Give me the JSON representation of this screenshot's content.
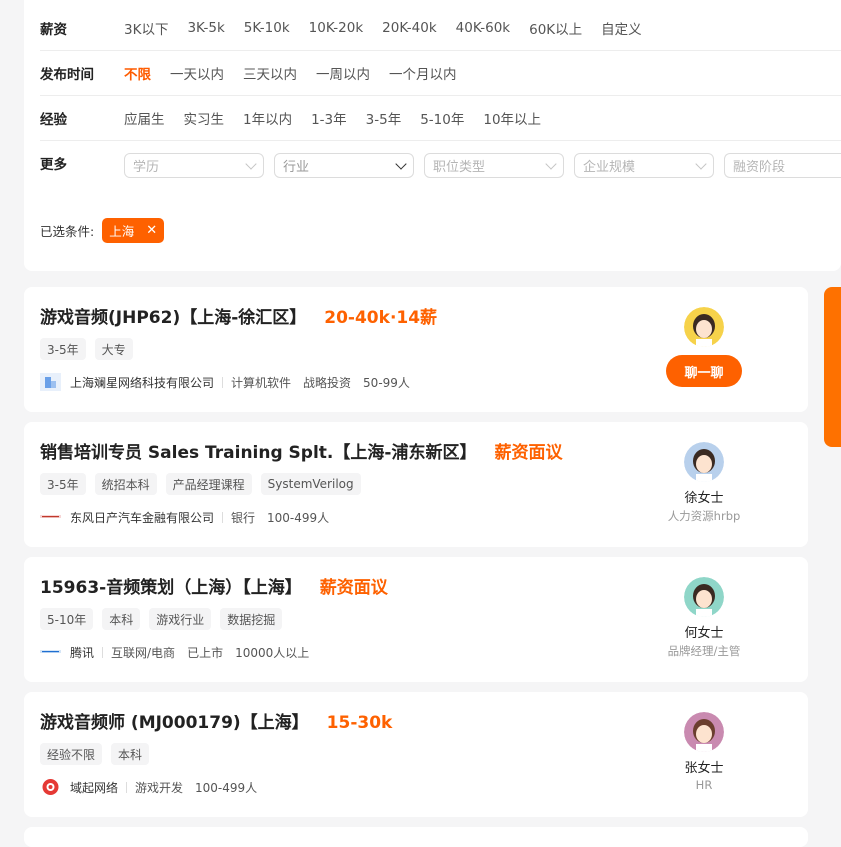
{
  "filters": {
    "salary": {
      "label": "薪资",
      "options": [
        "3K以下",
        "3K-5k",
        "5K-10k",
        "10K-20k",
        "20K-40k",
        "40K-60k",
        "60K以上",
        "自定义"
      ]
    },
    "publish_time": {
      "label": "发布时间",
      "options": [
        "不限",
        "一天以内",
        "三天以内",
        "一周以内",
        "一个月以内"
      ],
      "active": "不限"
    },
    "experience": {
      "label": "经验",
      "options": [
        "应届生",
        "实习生",
        "1年以内",
        "1-3年",
        "3-5年",
        "5-10年",
        "10年以上"
      ]
    },
    "more": {
      "label": "更多",
      "selects": [
        "学历",
        "行业",
        "职位类型",
        "企业规模",
        "融资阶段"
      ]
    },
    "selected": {
      "label": "已选条件:",
      "chips": [
        "上海"
      ]
    }
  },
  "jobs": [
    {
      "title": "游戏音频(JHP62)【上海-徐汇区】",
      "salary": "20-40k·14薪",
      "tags": [
        "3-5年",
        "大专"
      ],
      "company": "上海斓星网络科技有限公司",
      "meta": [
        "计算机软件",
        "战略投资",
        "50-99人"
      ],
      "recruiter_name": "",
      "recruiter_title": "",
      "chat_label": "聊一聊"
    },
    {
      "title": "销售培训专员 Sales Training Splt.【上海-浦东新区】",
      "salary": "薪资面议",
      "tags": [
        "3-5年",
        "统招本科",
        "产品经理课程",
        "SystemVerilog"
      ],
      "company": "东风日产汽车金融有限公司",
      "meta": [
        "银行",
        "100-499人"
      ],
      "recruiter_name": "徐女士",
      "recruiter_title": "人力资源hrbp"
    },
    {
      "title": "15963-音频策划（上海）【上海】",
      "salary": "薪资面议",
      "tags": [
        "5-10年",
        "本科",
        "游戏行业",
        "数据挖掘"
      ],
      "company": "腾讯",
      "meta": [
        "互联网/电商",
        "已上市",
        "10000人以上"
      ],
      "recruiter_name": "何女士",
      "recruiter_title": "品牌经理/主管"
    },
    {
      "title": "游戏音频师 (MJ000179)【上海】",
      "salary": "15-30k",
      "tags": [
        "经验不限",
        "本科"
      ],
      "company": "域起网络",
      "meta": [
        "游戏开发",
        "100-499人"
      ],
      "recruiter_name": "张女士",
      "recruiter_title": "HR"
    }
  ],
  "colors": {
    "accent": "#fe6100",
    "bg": "#f5f5f6"
  }
}
